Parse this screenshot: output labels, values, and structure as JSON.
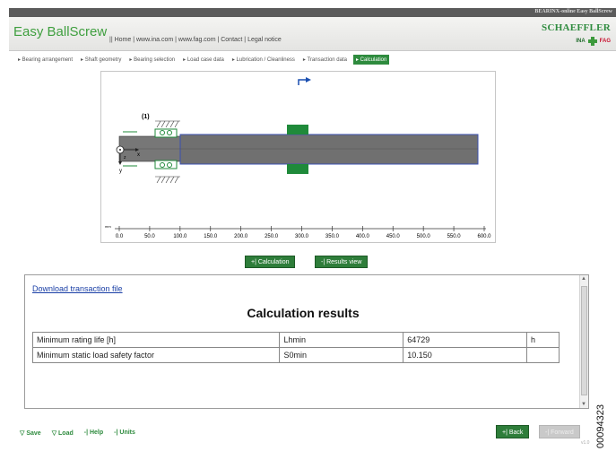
{
  "topbar": {
    "tag": "BEARINX-online Easy BallScrew"
  },
  "header": {
    "app_title": "Easy BallScrew",
    "nav_links": "|| Home | www.ina.com | www.fag.com | Contact | Legal notice",
    "brand": "SCHAEFFLER",
    "brand_ik": "INA",
    "brand_fag": "FAG"
  },
  "steps": [
    {
      "label": "▸ Bearing arrangement"
    },
    {
      "label": "▸ Shaft geometry"
    },
    {
      "label": "▸ Bearing selection"
    },
    {
      "label": "▸ Load case data"
    },
    {
      "label": "▸ Lubrication / Cleanliness"
    },
    {
      "label": "▸ Transaction data"
    },
    {
      "label": "▸ Calculation"
    }
  ],
  "diagram": {
    "bearing_label": "(1)",
    "axis_x_label": "x",
    "axis_y_label": "y",
    "axis_z_label": "z",
    "unit_label": "mm",
    "ticks": [
      "0.0",
      "50.0",
      "100.0",
      "150.0",
      "200.0",
      "250.0",
      "300.0",
      "350.0",
      "400.0",
      "450.0",
      "500.0",
      "550.0",
      "600.0"
    ]
  },
  "buttons": {
    "calculation": "+| Calculation",
    "results_view": "-| Results view"
  },
  "results": {
    "download_link": "Download transaction file",
    "title": "Calculation results",
    "rows": [
      {
        "name": "Minimum rating life [h]",
        "symbol": "Lhmin",
        "value": "64729",
        "unit": "h"
      },
      {
        "name": "Minimum static load safety factor",
        "symbol": "S0min",
        "value": "10.150",
        "unit": ""
      }
    ]
  },
  "footer": {
    "save": "▽ Save",
    "load": "▽ Load",
    "help": "-| Help",
    "units": "-| Units",
    "back": "+| Back",
    "forward": "-| Forward",
    "version": "v1.0"
  },
  "doc_number": "00094323",
  "colors": {
    "accent": "#2e7d3a",
    "shaft": "#6f6f6f",
    "link": "#1a3fa6"
  }
}
